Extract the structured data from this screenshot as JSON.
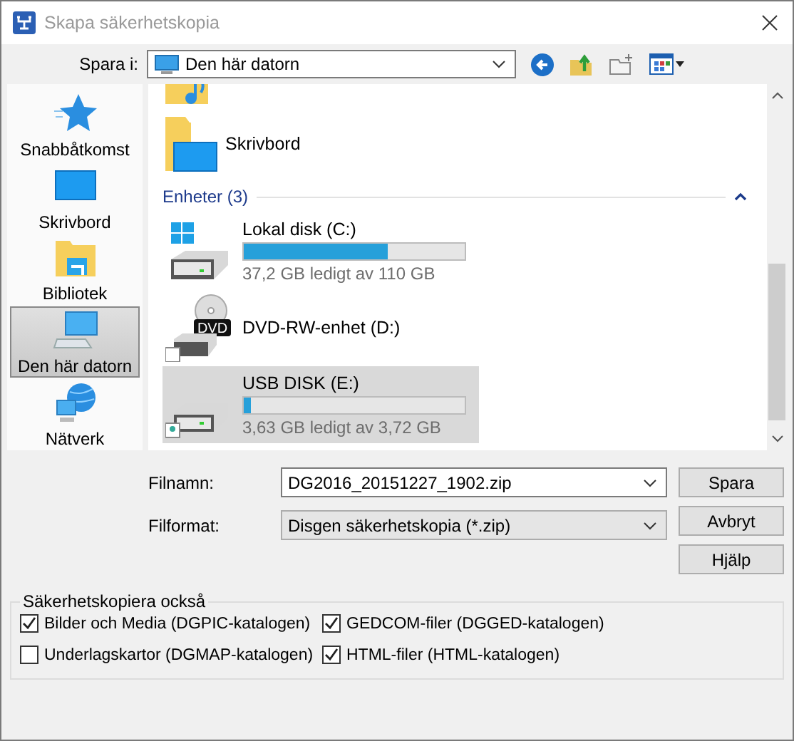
{
  "window": {
    "title": "Skapa säkerhetskopia"
  },
  "save_in": {
    "label": "Spara i:",
    "value": "Den här datorn"
  },
  "places": [
    {
      "kind": "star",
      "label": "Snabbåtkomst",
      "selected": false
    },
    {
      "kind": "desktop",
      "label": "Skrivbord",
      "selected": false
    },
    {
      "kind": "library",
      "label": "Bibliotek",
      "selected": false
    },
    {
      "kind": "computer",
      "label": "Den här datorn",
      "selected": true
    },
    {
      "kind": "network",
      "label": "Nätverk",
      "selected": false
    }
  ],
  "file_list": {
    "folders": [
      {
        "kind": "desktop",
        "name": "Skrivbord"
      }
    ],
    "group": {
      "title": "Enheter (3)",
      "expanded": true
    },
    "drives": [
      {
        "kind": "windows",
        "name": "Lokal disk (C:)",
        "level": 0.65,
        "reading": "37,2 GB ledigt av 110 GB",
        "selected": false
      },
      {
        "kind": "dvd",
        "icon_text": "DVD",
        "name": "DVD-RW-enhet (D:)",
        "selected": false
      },
      {
        "kind": "usb",
        "name": "USB DISK (E:)",
        "level": 0.03,
        "reading": "3,63 GB ledigt av 3,72 GB",
        "selected": true
      }
    ]
  },
  "filename": {
    "label": "Filnamn:",
    "value": "DG2016_20151227_1902.zip"
  },
  "format": {
    "label": "Filformat:",
    "value": "Disgen säkerhetskopia (*.zip)"
  },
  "buttons": [
    "Spara",
    "Avbryt",
    "Hjälp"
  ],
  "also_backup": {
    "title": "Säkerhetskopiera också",
    "options": [
      {
        "label": "Bilder och Media (DGPIC-katalogen)",
        "checked": true
      },
      {
        "label": "GEDCOM-filer (DGGED-katalogen)",
        "checked": true
      },
      {
        "label": "Underlagskartor (DGMAP-katalogen)",
        "checked": false
      },
      {
        "label": "HTML-filer (HTML-katalogen)",
        "checked": true
      }
    ]
  }
}
